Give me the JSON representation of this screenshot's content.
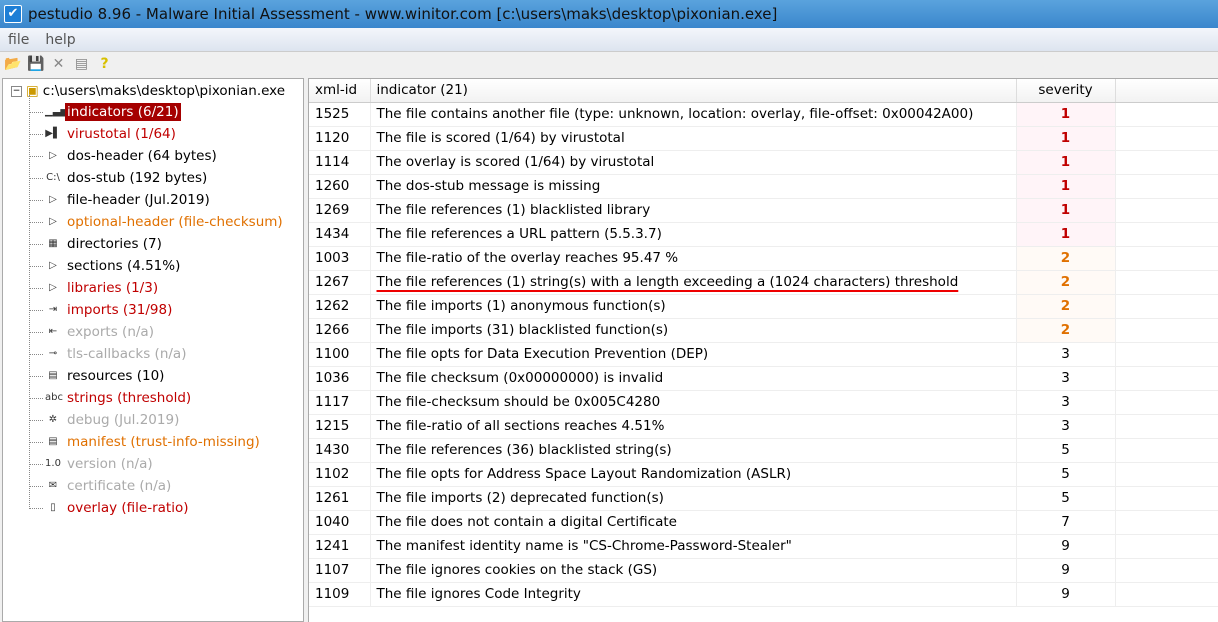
{
  "title": "pestudio 8.96 - Malware Initial Assessment - www.winitor.com [c:\\users\\maks\\desktop\\pixonian.exe]",
  "menu": [
    "file",
    "help"
  ],
  "toolbar": [
    "open-icon",
    "save-icon",
    "close-icon",
    "clipboard-icon",
    "help-icon"
  ],
  "tree": {
    "root": "c:\\users\\maks\\desktop\\pixonian.exe",
    "items": [
      {
        "label": "indicators (6/21)",
        "color": "sel",
        "icon": "▁▃▅"
      },
      {
        "label": "virustotal (1/64)",
        "color": "c-red",
        "icon": "▶▌"
      },
      {
        "label": "dos-header (64 bytes)",
        "color": "c-black",
        "icon": "▷"
      },
      {
        "label": "dos-stub (192 bytes)",
        "color": "c-black",
        "icon": "C:\\"
      },
      {
        "label": "file-header (Jul.2019)",
        "color": "c-black",
        "icon": "▷"
      },
      {
        "label": "optional-header (file-checksum)",
        "color": "c-orange",
        "icon": "▷"
      },
      {
        "label": "directories (7)",
        "color": "c-black",
        "icon": "▦"
      },
      {
        "label": "sections (4.51%)",
        "color": "c-black",
        "icon": "▷"
      },
      {
        "label": "libraries (1/3)",
        "color": "c-red",
        "icon": "▷"
      },
      {
        "label": "imports (31/98)",
        "color": "c-red",
        "icon": "⇥"
      },
      {
        "label": "exports (n/a)",
        "color": "c-gray",
        "icon": "⇤"
      },
      {
        "label": "tls-callbacks (n/a)",
        "color": "c-gray",
        "icon": "⊸"
      },
      {
        "label": "resources (10)",
        "color": "c-black",
        "icon": "▤"
      },
      {
        "label": "strings (threshold)",
        "color": "c-red",
        "icon": "abc"
      },
      {
        "label": "debug (Jul.2019)",
        "color": "c-gray",
        "icon": "✲"
      },
      {
        "label": "manifest (trust-info-missing)",
        "color": "c-orange",
        "icon": "▤"
      },
      {
        "label": "version (n/a)",
        "color": "c-gray",
        "icon": "1.0"
      },
      {
        "label": "certificate (n/a)",
        "color": "c-gray",
        "icon": "✉"
      },
      {
        "label": "overlay (file-ratio)",
        "color": "c-red",
        "icon": "▯"
      }
    ]
  },
  "table": {
    "headers": [
      "xml-id",
      "indicator (21)",
      "severity",
      ""
    ],
    "rows": [
      [
        "1525",
        "The file contains another file (type: unknown, location: overlay, file-offset: 0x00042A00)",
        "1"
      ],
      [
        "1120",
        "The file is scored (1/64) by virustotal",
        "1"
      ],
      [
        "1114",
        "The overlay is scored (1/64) by virustotal",
        "1"
      ],
      [
        "1260",
        "The dos-stub message is missing",
        "1"
      ],
      [
        "1269",
        "The file references (1) blacklisted library",
        "1"
      ],
      [
        "1434",
        "The file references a URL pattern (5.5.3.7)",
        "1"
      ],
      [
        "1003",
        "The file-ratio of the overlay reaches 95.47 %",
        "2"
      ],
      [
        "1267",
        "The file references (1) string(s) with a length exceeding a (1024 characters) threshold",
        "2"
      ],
      [
        "1262",
        "The file imports (1) anonymous function(s)",
        "2"
      ],
      [
        "1266",
        "The file imports (31) blacklisted function(s)",
        "2"
      ],
      [
        "1100",
        "The file opts for Data Execution Prevention (DEP)",
        "3"
      ],
      [
        "1036",
        "The file checksum (0x00000000) is invalid",
        "3"
      ],
      [
        "1117",
        "The file-checksum should be 0x005C4280",
        "3"
      ],
      [
        "1215",
        "The file-ratio of all sections reaches 4.51%",
        "3"
      ],
      [
        "1430",
        "The file references (36) blacklisted string(s)",
        "5"
      ],
      [
        "1102",
        "The file opts for Address Space Layout Randomization (ASLR)",
        "5"
      ],
      [
        "1261",
        "The file imports (2) deprecated function(s)",
        "5"
      ],
      [
        "1040",
        "The file does not contain a digital Certificate",
        "7"
      ],
      [
        "1241",
        "The manifest identity name is \"CS-Chrome-Password-Stealer\"",
        "9"
      ],
      [
        "1107",
        "The file ignores cookies on the stack (GS)",
        "9"
      ],
      [
        "1109",
        "The file ignores Code Integrity",
        "9"
      ]
    ],
    "underlined_row": 7
  }
}
